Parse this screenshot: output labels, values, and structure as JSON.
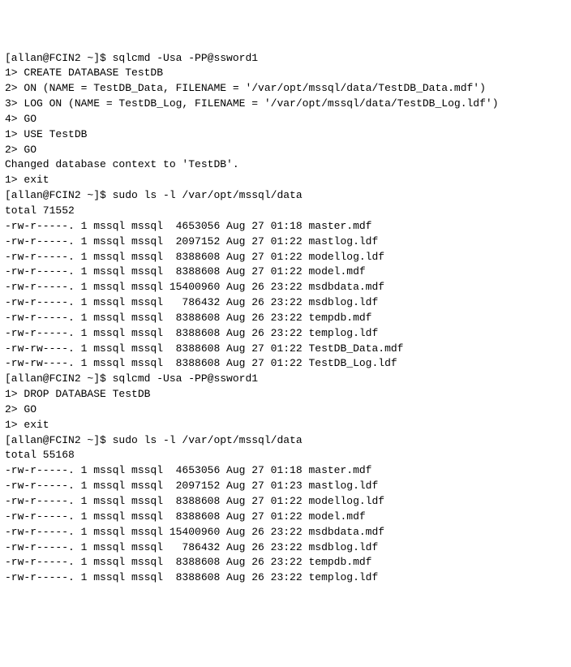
{
  "lines": [
    "[allan@FCIN2 ~]$ sqlcmd -Usa -PP@ssword1",
    "1> CREATE DATABASE TestDB",
    "2> ON (NAME = TestDB_Data, FILENAME = '/var/opt/mssql/data/TestDB_Data.mdf')",
    "3> LOG ON (NAME = TestDB_Log, FILENAME = '/var/opt/mssql/data/TestDB_Log.ldf')",
    "4> GO",
    "1> USE TestDB",
    "2> GO",
    "Changed database context to 'TestDB'.",
    "1> exit",
    "[allan@FCIN2 ~]$ sudo ls -l /var/opt/mssql/data",
    "total 71552",
    "-rw-r-----. 1 mssql mssql  4653056 Aug 27 01:18 master.mdf",
    "-rw-r-----. 1 mssql mssql  2097152 Aug 27 01:22 mastlog.ldf",
    "-rw-r-----. 1 mssql mssql  8388608 Aug 27 01:22 modellog.ldf",
    "-rw-r-----. 1 mssql mssql  8388608 Aug 27 01:22 model.mdf",
    "-rw-r-----. 1 mssql mssql 15400960 Aug 26 23:22 msdbdata.mdf",
    "-rw-r-----. 1 mssql mssql   786432 Aug 26 23:22 msdblog.ldf",
    "-rw-r-----. 1 mssql mssql  8388608 Aug 26 23:22 tempdb.mdf",
    "-rw-r-----. 1 mssql mssql  8388608 Aug 26 23:22 templog.ldf",
    "-rw-rw----. 1 mssql mssql  8388608 Aug 27 01:22 TestDB_Data.mdf",
    "-rw-rw----. 1 mssql mssql  8388608 Aug 27 01:22 TestDB_Log.ldf",
    "[allan@FCIN2 ~]$ sqlcmd -Usa -PP@ssword1",
    "1> DROP DATABASE TestDB",
    "2> GO",
    "1> exit",
    "[allan@FCIN2 ~]$ sudo ls -l /var/opt/mssql/data",
    "total 55168",
    "-rw-r-----. 1 mssql mssql  4653056 Aug 27 01:18 master.mdf",
    "-rw-r-----. 1 mssql mssql  2097152 Aug 27 01:23 mastlog.ldf",
    "-rw-r-----. 1 mssql mssql  8388608 Aug 27 01:22 modellog.ldf",
    "-rw-r-----. 1 mssql mssql  8388608 Aug 27 01:22 model.mdf",
    "-rw-r-----. 1 mssql mssql 15400960 Aug 26 23:22 msdbdata.mdf",
    "-rw-r-----. 1 mssql mssql   786432 Aug 26 23:22 msdblog.ldf",
    "-rw-r-----. 1 mssql mssql  8388608 Aug 26 23:22 tempdb.mdf",
    "-rw-r-----. 1 mssql mssql  8388608 Aug 26 23:22 templog.ldf"
  ]
}
